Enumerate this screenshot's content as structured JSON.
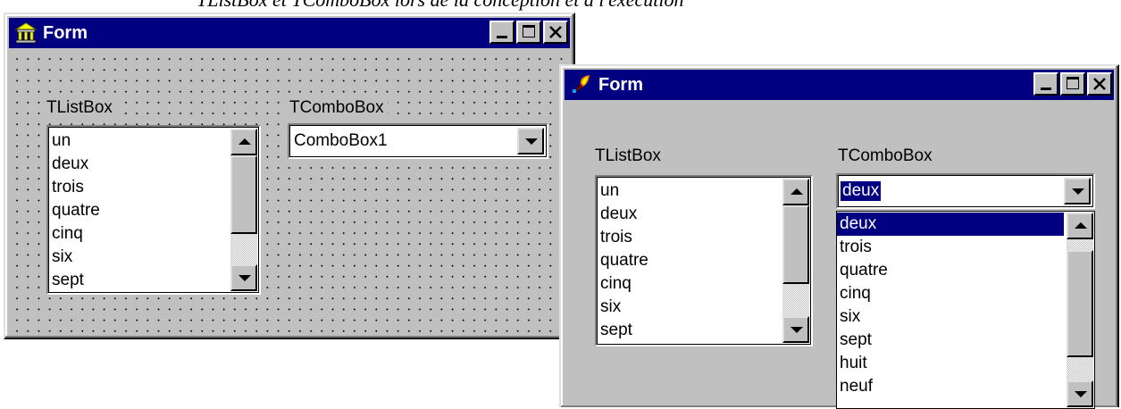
{
  "caption": "TListBox et TComboBox lors de la conception et à l'exécution",
  "design_window": {
    "title": "Form",
    "app_icon": "delphi-form-icon",
    "listbox_label": "TListBox",
    "combobox_label": "TComboBox",
    "listbox_items": [
      "un",
      "deux",
      "trois",
      "quatre",
      "cinq",
      "six",
      "sept"
    ],
    "combobox_value": "ComboBox1"
  },
  "runtime_window": {
    "title": "Form",
    "app_icon": "torch-icon",
    "listbox_label": "TListBox",
    "combobox_label": "TComboBox",
    "listbox_items": [
      "un",
      "deux",
      "trois",
      "quatre",
      "cinq",
      "six",
      "sept"
    ],
    "combobox_value": "deux",
    "dropdown_items": [
      "deux",
      "trois",
      "quatre",
      "cinq",
      "six",
      "sept",
      "huit",
      "neuf"
    ],
    "selected_dropdown_item": "deux"
  },
  "colors": {
    "titlebar": "#000080",
    "face": "#c0c0c0",
    "selection": "#000080"
  }
}
